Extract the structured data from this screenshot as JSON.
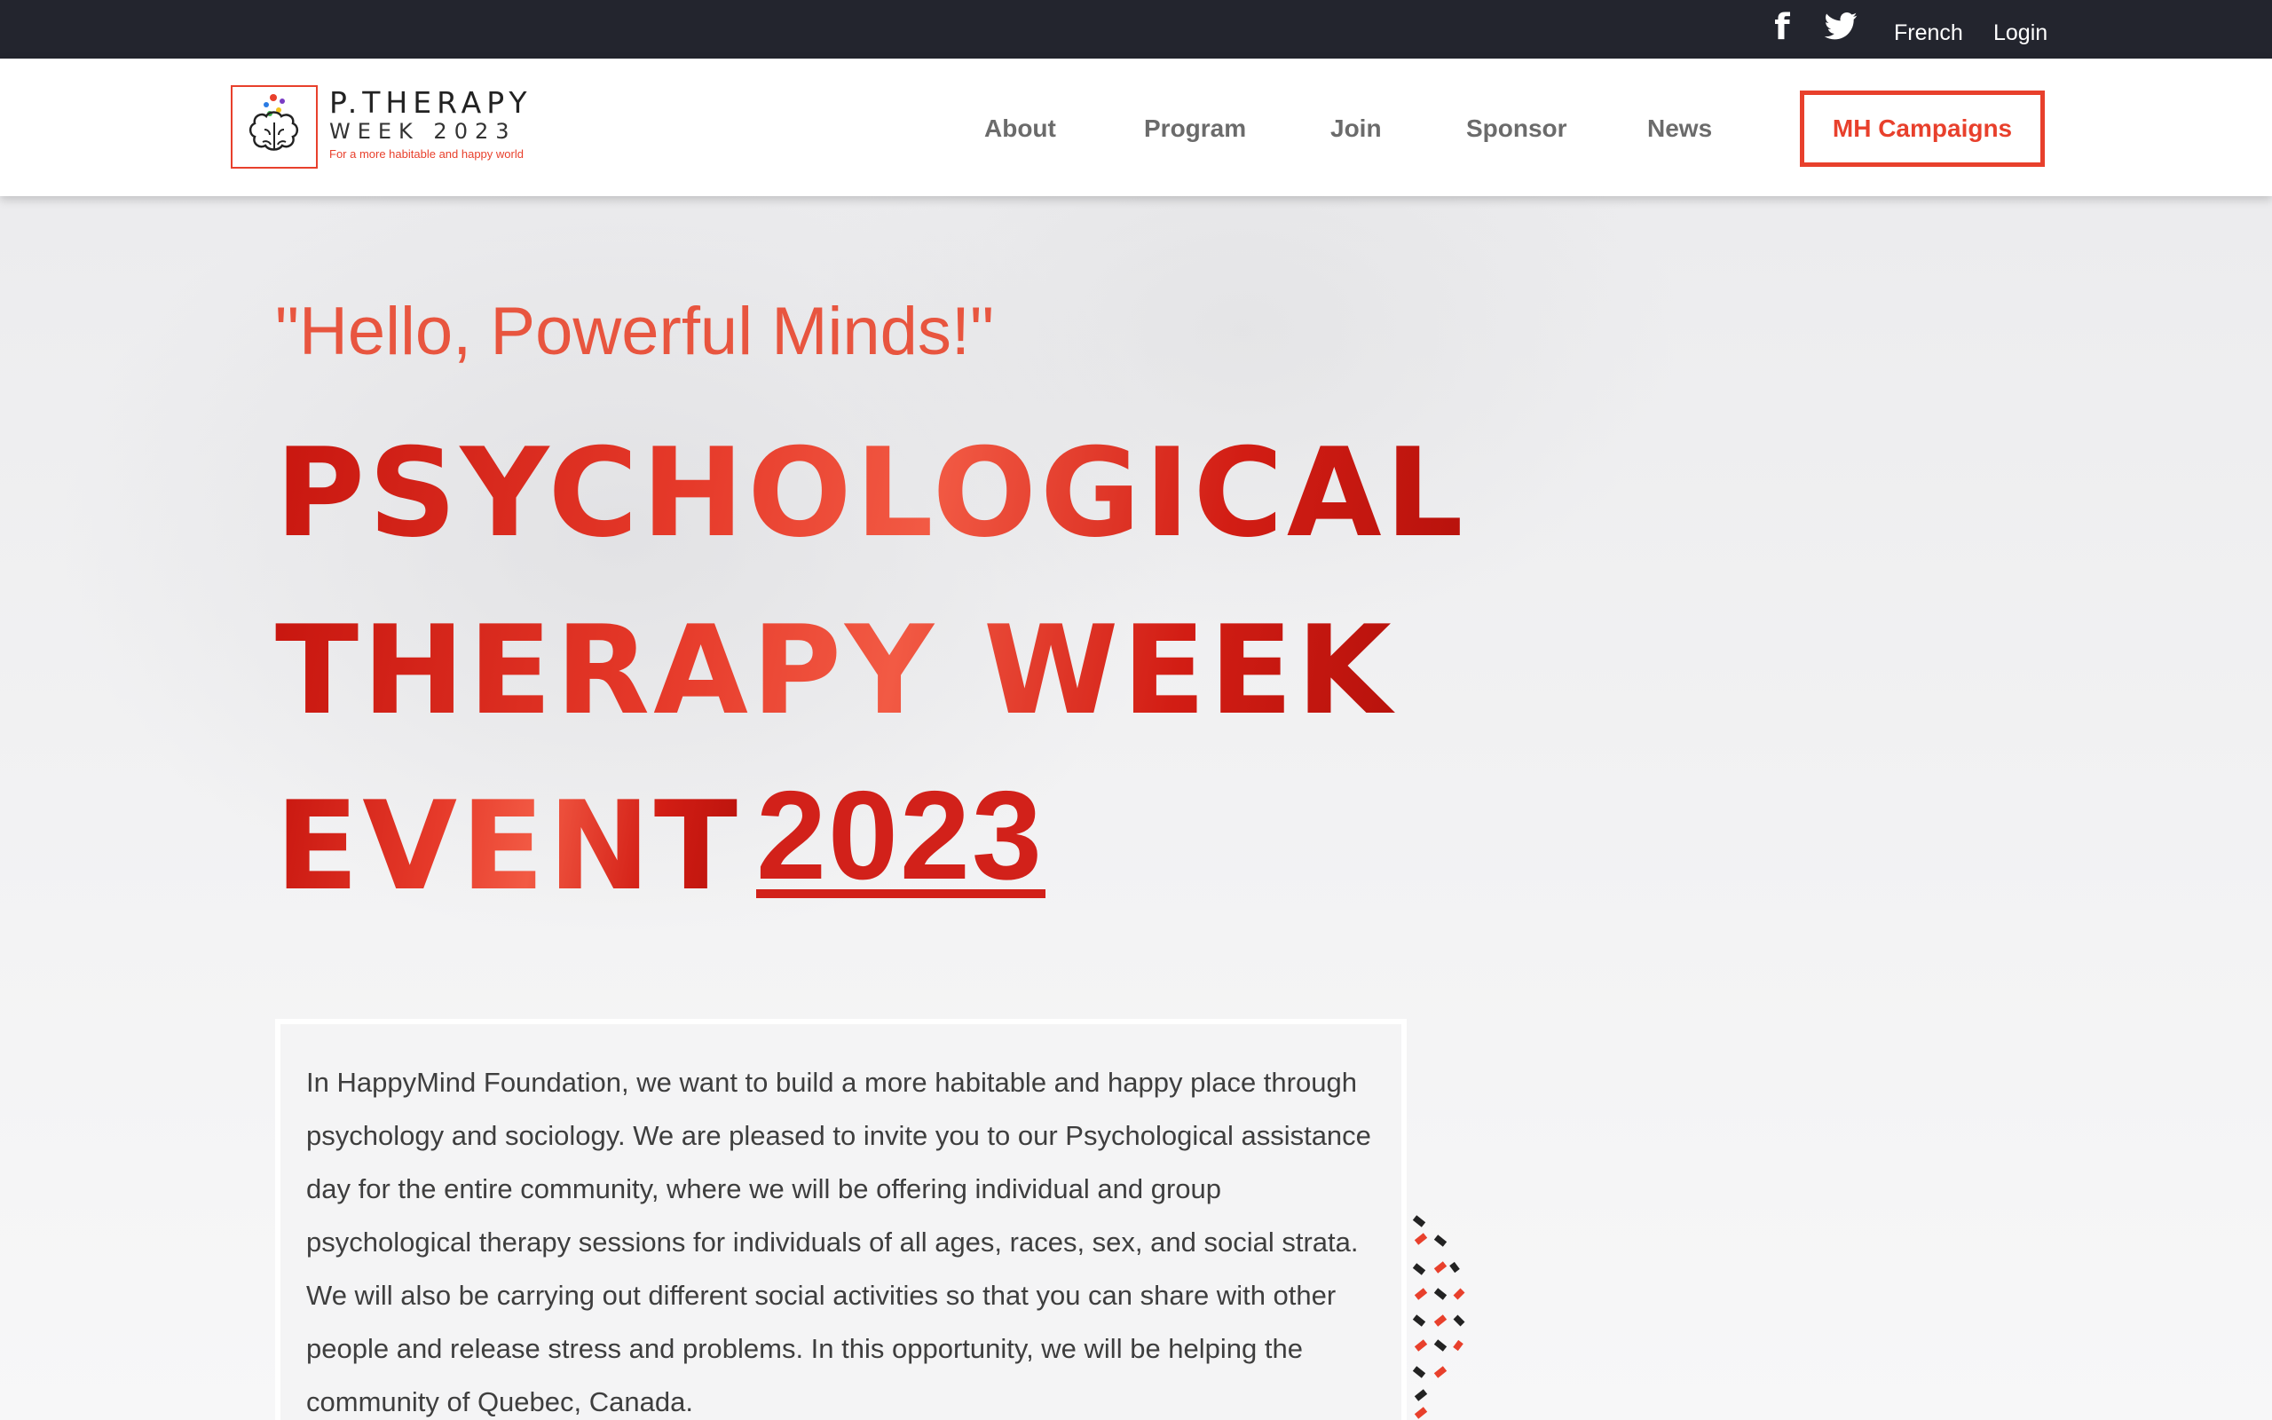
{
  "topbar": {
    "icons": [
      "facebook-icon",
      "twitter-icon"
    ],
    "language_link": "French",
    "login_link": "Login"
  },
  "brand": {
    "title": "P.THERAPY",
    "subtitle": "WEEK 2023",
    "tagline": "For a more habitable and happy world",
    "accent": "#e8402c"
  },
  "nav": {
    "items": [
      "About",
      "Program",
      "Join",
      "Sponsor",
      "News"
    ],
    "cta_label": "MH Campaigns"
  },
  "hero": {
    "greeting": "\"Hello, Powerful Minds!\"",
    "headline_line1": "PSYCHOLOGICAL",
    "headline_line2": "THERAPY WEEK",
    "headline_line3": "EVENT",
    "headline_year": "2023",
    "intro": "In HappyMind Foundation, we want to build a more habitable and happy place through psychology and sociology. We are pleased to invite you to our Psychological assistance day for the entire community, where we will be offering individual and group psychological therapy sessions for individuals of all ages, races, sex, and social strata. We will also be carrying out different social activities so that you can share with other people and release stress and problems. In this opportunity, we will be helping the community of Quebec, Canada."
  },
  "colors": {
    "topbar_bg": "#23252e",
    "headline_red": "#d2211a",
    "greeting_red": "#e8553f",
    "nav_text": "#6b6b6b"
  }
}
